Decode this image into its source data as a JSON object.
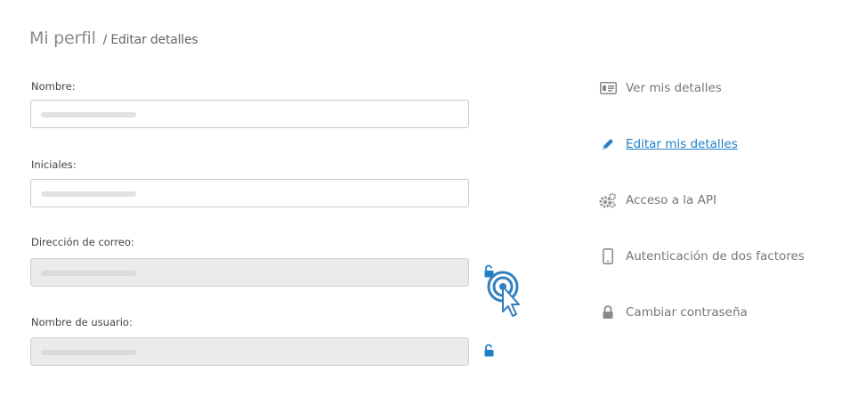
{
  "header": {
    "title": "Mi perfil",
    "subtitle": "/ Editar detalles"
  },
  "form": {
    "name_label": "Nombre:",
    "initials_label": "Iniciales:",
    "email_label": "Dirección de correo:",
    "username_label": "Nombre de usuario:"
  },
  "sidebar": {
    "items": [
      {
        "label": "Ver mis detalles",
        "icon": "id-card-icon"
      },
      {
        "label": "Editar mis detalles",
        "icon": "pencil-icon",
        "active": true
      },
      {
        "label": "Acceso a la API",
        "icon": "gears-icon"
      },
      {
        "label": "Autenticación de dos factores",
        "icon": "phone-icon"
      },
      {
        "label": "Cambiar contraseña",
        "icon": "lock-icon"
      }
    ]
  },
  "colors": {
    "accent": "#1f7fc7",
    "muted_text": "#777777",
    "field_border": "#c8c8c8",
    "disabled_bg": "#ebebeb"
  }
}
